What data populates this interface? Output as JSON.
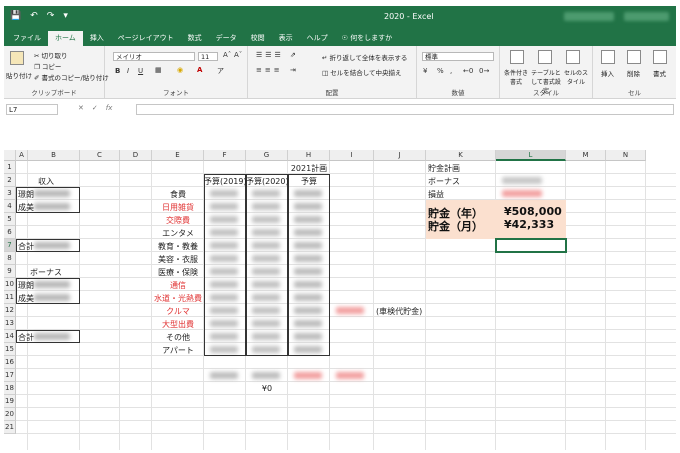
{
  "window": {
    "title": "2020 - Excel"
  },
  "tabs": [
    {
      "label": "ファイル",
      "active": false
    },
    {
      "label": "ホーム",
      "active": true
    },
    {
      "label": "挿入",
      "active": false
    },
    {
      "label": "ページレイアウト",
      "active": false
    },
    {
      "label": "数式",
      "active": false
    },
    {
      "label": "データ",
      "active": false
    },
    {
      "label": "校閲",
      "active": false
    },
    {
      "label": "表示",
      "active": false
    },
    {
      "label": "ヘルプ",
      "active": false
    },
    {
      "label": "何をしますか",
      "active": false
    }
  ],
  "ribbon": {
    "clipboard": {
      "paste": "貼り付け",
      "cut": "切り取り",
      "copy": "コピー",
      "format_painter": "書式のコピー/貼り付け",
      "label": "クリップボード"
    },
    "font": {
      "font_name": "メイリオ",
      "font_size": "11",
      "label": "フォント",
      "bold": "B",
      "italic": "I",
      "underline": "U"
    },
    "alignment": {
      "wrap": "折り返して全体を表示する",
      "merge": "セルを結合して中央揃え",
      "label": "配置"
    },
    "number": {
      "format": "標準",
      "label": "数値"
    },
    "styles": {
      "conditional": "条件付き書式",
      "table": "テーブルとして書式設定",
      "cell_styles": "セルのスタイル",
      "label": "スタイル"
    },
    "cells": {
      "insert": "挿入",
      "delete": "削除",
      "format": "書式",
      "label": "セル"
    }
  },
  "formula_bar": {
    "name_box": "L7",
    "fx": "fx",
    "value": ""
  },
  "sheet": {
    "columns": [
      "A",
      "B",
      "C",
      "D",
      "E",
      "F",
      "G",
      "H",
      "I",
      "J",
      "K",
      "L",
      "M",
      "N"
    ],
    "selected_column": "L",
    "rows": [
      "1",
      "2",
      "3",
      "4",
      "5",
      "6",
      "7",
      "8",
      "9",
      "10",
      "11",
      "12",
      "13",
      "14",
      "15",
      "16",
      "17",
      "18",
      "19",
      "20",
      "21"
    ],
    "selected_row": "7",
    "selected_cell": "L7",
    "cells": {
      "b2": "収入",
      "a3": "璟朗",
      "a4": "成美",
      "a7": "合計",
      "b9": "ボーナス",
      "a10": "璟朗",
      "a11": "成美",
      "a14": "合計",
      "e3": "食費",
      "e4": "日用雑貨",
      "e5": "交際費",
      "e6": "エンタメ",
      "e7": "教育・教養",
      "e8": "美容・衣服",
      "e9": "医療・保険",
      "e10": "通信",
      "e11": "水道・光熱費",
      "e12": "クルマ",
      "e13": "大型出費",
      "e14": "その他",
      "e15": "アパート",
      "h1": "2021計画",
      "f2": "予算(2019)",
      "g2": "予算(2020)",
      "h2": "予算",
      "j12": "(車検代貯金)",
      "g18": "¥0",
      "k1": "貯金計画",
      "k2": "ボーナス",
      "k3": "損益",
      "k4": "貯金（年）",
      "k5": "貯金（月）",
      "l4": "¥508,000",
      "l5": "¥42,333"
    }
  }
}
